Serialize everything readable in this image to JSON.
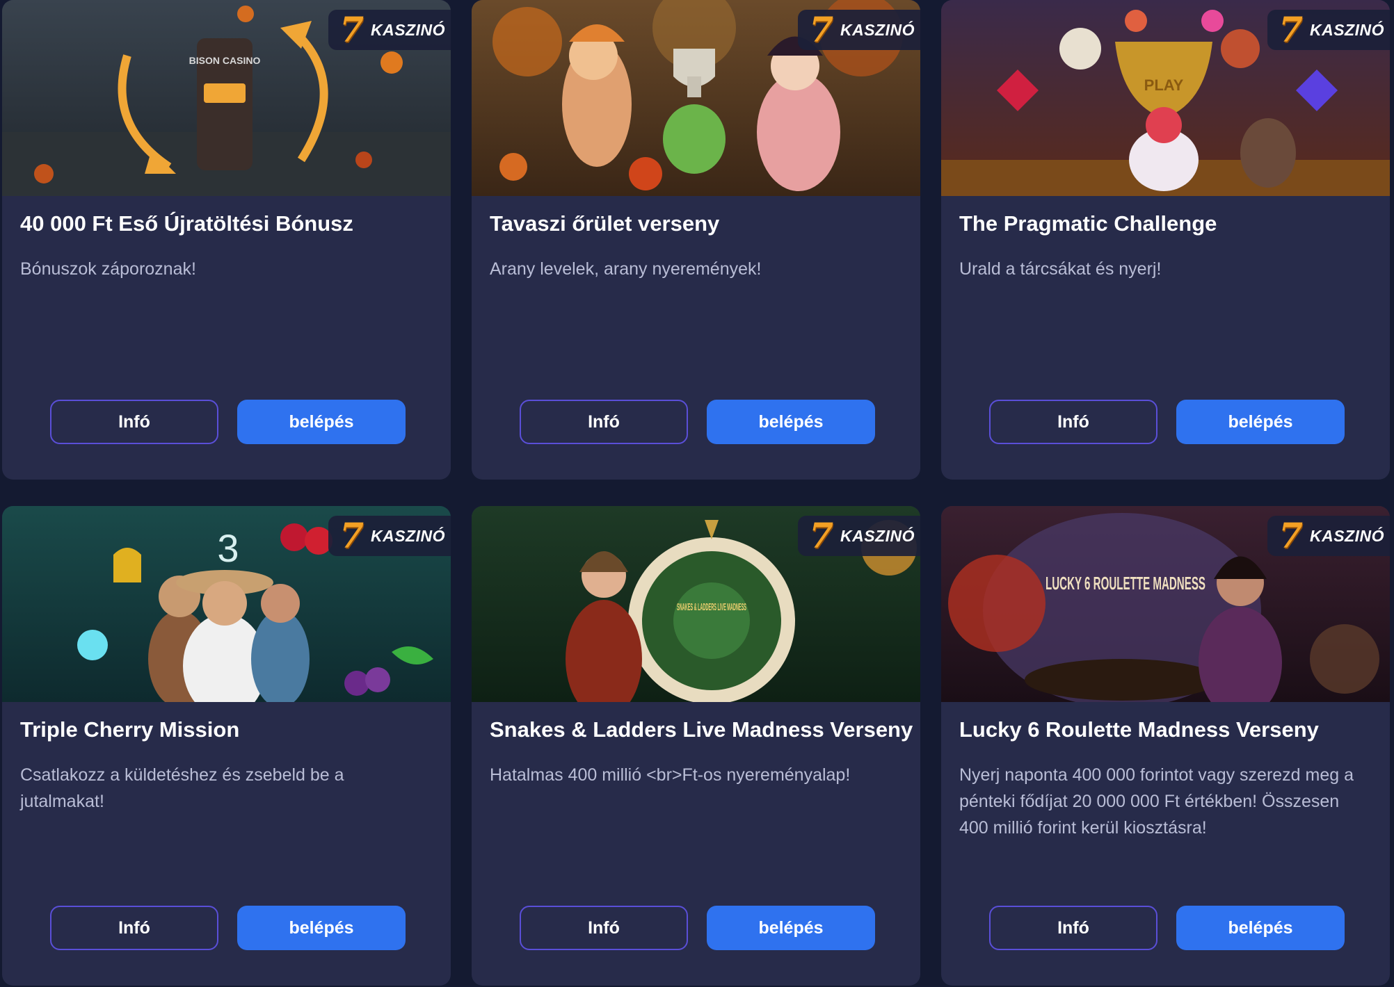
{
  "badge": {
    "number": "7",
    "label": "KASZINÓ",
    "number_color": "#f3a024"
  },
  "colors": {
    "background": "#141a31",
    "card": "#272b4a",
    "primary_button": "#2f72ef",
    "outline_button_border": "#5a4fd8"
  },
  "cards": [
    {
      "title": "40 000 Ft Eső Újratöltési Bónusz",
      "description": "Bónuszok záporoznak!",
      "info_label": "Infó",
      "enter_label": "belépés",
      "image_text": "BISON CASINO"
    },
    {
      "title": "Tavaszi őrület verseny",
      "description": "Arany levelek, arany nyeremények!",
      "info_label": "Infó",
      "enter_label": "belépés"
    },
    {
      "title": "The Pragmatic Challenge",
      "description": "Urald a tárcsákat és nyerj!",
      "info_label": "Infó",
      "enter_label": "belépés",
      "image_text": "PLAY"
    },
    {
      "title": "Triple Cherry Mission",
      "description": "Csatlakozz a küldetéshez és zsebeld be a jutalmakat!",
      "info_label": "Infó",
      "enter_label": "belépés",
      "image_text": "3"
    },
    {
      "title": "Snakes & Ladders Live Madness Verseny",
      "description": "Hatalmas 400 millió <br>Ft-os nyereményalap!",
      "info_label": "Infó",
      "enter_label": "belépés",
      "image_text": "SNAKES & LADDERS LIVE MADNESS"
    },
    {
      "title": "Lucky 6 Roulette Madness Verseny",
      "description": "Nyerj naponta 400 000 forintot vagy szerezd meg a pénteki fődíjat 20 000 000 Ft értékben! Összesen 400 millió forint kerül kiosztásra!",
      "info_label": "Infó",
      "enter_label": "belépés",
      "image_text": "LUCKY 6 ROULETTE MADNESS"
    }
  ]
}
